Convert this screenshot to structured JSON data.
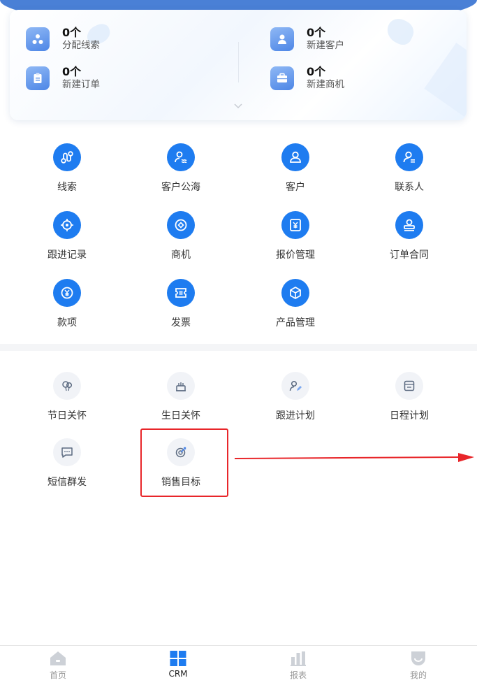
{
  "stats": [
    {
      "value": "0个",
      "label": "分配线索",
      "icon": "share-nodes-icon"
    },
    {
      "value": "0个",
      "label": "新建客户",
      "icon": "user-icon"
    },
    {
      "value": "0个",
      "label": "新建订单",
      "icon": "clipboard-icon"
    },
    {
      "value": "0个",
      "label": "新建商机",
      "icon": "briefcase-icon"
    }
  ],
  "modules": [
    {
      "label": "线索",
      "icon": "route-icon"
    },
    {
      "label": "客户公海",
      "icon": "user-waves-icon"
    },
    {
      "label": "客户",
      "icon": "user-icon"
    },
    {
      "label": "联系人",
      "icon": "contact-card-icon"
    },
    {
      "label": "跟进记录",
      "icon": "crosshair-icon"
    },
    {
      "label": "商机",
      "icon": "target-diamond-icon"
    },
    {
      "label": "报价管理",
      "icon": "yen-document-icon"
    },
    {
      "label": "订单合同",
      "icon": "stamp-icon"
    },
    {
      "label": "款项",
      "icon": "yen-coin-icon"
    },
    {
      "label": "发票",
      "icon": "ticket-icon"
    },
    {
      "label": "产品管理",
      "icon": "cube-icon"
    }
  ],
  "tools": [
    {
      "label": "节日关怀",
      "icon": "balloon-icon"
    },
    {
      "label": "生日关怀",
      "icon": "cake-icon"
    },
    {
      "label": "跟进计划",
      "icon": "user-pen-icon"
    },
    {
      "label": "日程计划",
      "icon": "calendar-icon"
    },
    {
      "label": "短信群发",
      "icon": "message-icon"
    },
    {
      "label": "销售目标",
      "icon": "target-arrow-icon"
    }
  ],
  "tabbar": [
    {
      "label": "首页",
      "icon": "home-icon"
    },
    {
      "label": "CRM",
      "icon": "grid-icon"
    },
    {
      "label": "报表",
      "icon": "bar-chart-icon"
    },
    {
      "label": "我的",
      "icon": "profile-icon"
    }
  ],
  "colors": {
    "primary": "#1e7cf0",
    "highlight": "#e8262a",
    "header": "#4a80d6"
  }
}
